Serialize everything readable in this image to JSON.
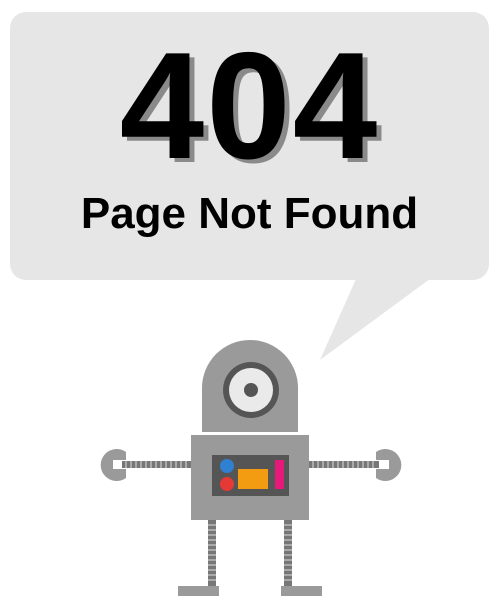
{
  "error": {
    "code": "404",
    "message": "Page Not Found"
  },
  "illustration": {
    "subject": "robot",
    "icons": [
      "speech-bubble",
      "robot-eye",
      "wrench-hand",
      "spring-leg"
    ]
  },
  "colors": {
    "bubble": "#e6e6e6",
    "text": "#000000",
    "text_shadow": "#8a8a8a",
    "robot_body": "#999999",
    "robot_dark": "#555555",
    "spring": "#777777",
    "panel_blue": "#2f80d1",
    "panel_red": "#e53935",
    "panel_orange": "#f39c12",
    "panel_pink": "#e6197a"
  }
}
